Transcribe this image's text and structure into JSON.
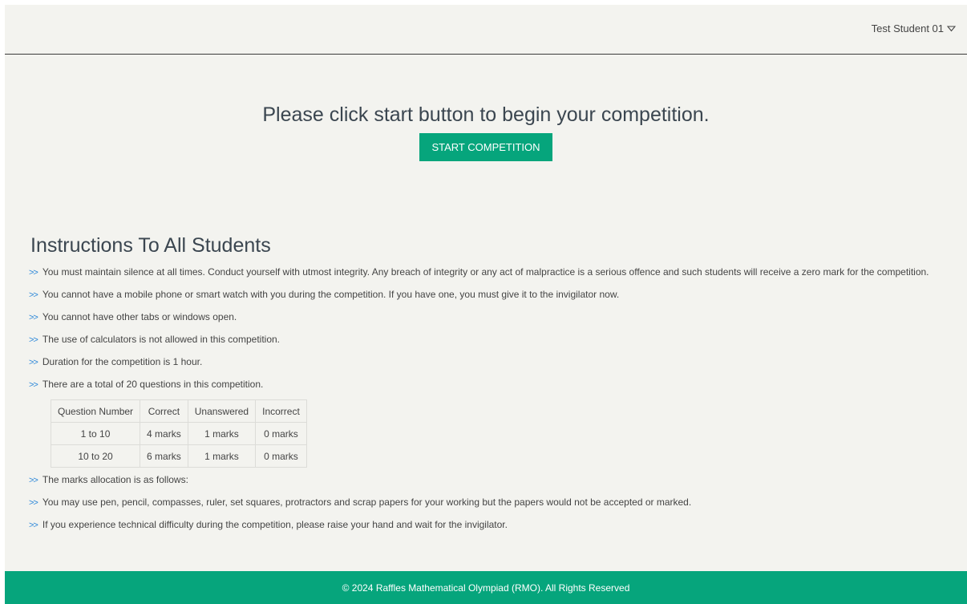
{
  "header": {
    "user_name": "Test Student 01"
  },
  "hero": {
    "title": "Please click start button to begin your competition.",
    "start_button": "START COMPETITION"
  },
  "instructions": {
    "title": "Instructions To All Students",
    "items": [
      "You must maintain silence at all times. Conduct yourself with utmost integrity. Any breach of integrity or any act of malpractice is a serious offence and such students will receive a zero mark for the competition.",
      "You cannot have a mobile phone or smart watch with you during the competition. If you have one, you must give it to the invigilator now.",
      "You cannot have other tabs or windows open.",
      "The use of calculators is not allowed in this competition.",
      "Duration for the competition is 1 hour.",
      "There are a total of 20 questions in this competition.",
      "The marks allocation is as follows:",
      "You may use pen, pencil, compasses, ruler, set squares, protractors and scrap papers for your working but the papers would not be accepted or marked.",
      "If you experience technical difficulty during the competition, please raise your hand and wait for the invigilator."
    ],
    "marks_table": {
      "headers": [
        "Question Number",
        "Correct",
        "Unanswered",
        "Incorrect"
      ],
      "rows": [
        [
          "1 to 10",
          "4 marks",
          "1 marks",
          "0 marks"
        ],
        [
          "10 to 20",
          "6 marks",
          "1 marks",
          "0 marks"
        ]
      ]
    }
  },
  "footer": {
    "text": "© 2024 Raffles Mathematical Olympiad (RMO). All Rights Reserved"
  },
  "colors": {
    "accent": "#06a57c",
    "background": "#f3f3ef",
    "bullet": "#2a86d8"
  },
  "icons": {
    "user_menu": "chevron-down-icon",
    "bullet": "double-chevron-right-icon"
  }
}
